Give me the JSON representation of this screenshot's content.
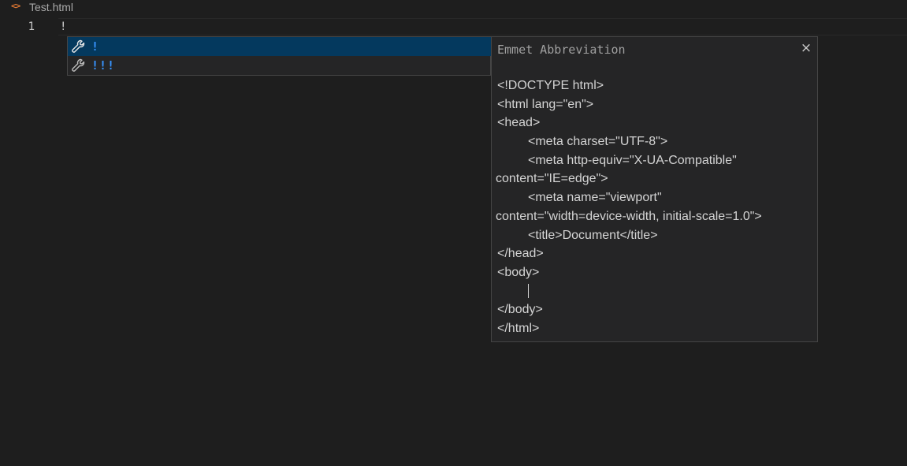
{
  "tab": {
    "icon": "html-file-icon",
    "file_icon_glyph": "<>",
    "file_name": "Test.html"
  },
  "editor": {
    "line_number": "1",
    "line_text": "!"
  },
  "suggest": {
    "items": [
      {
        "icon": "wrench-icon",
        "label": "!",
        "selected": true
      },
      {
        "icon": "wrench-icon",
        "label": "!!!",
        "selected": false
      }
    ],
    "label_color": "#3794ff"
  },
  "details": {
    "title": "Emmet Abbreviation",
    "close_glyph": "×",
    "lines": [
      "<!DOCTYPE html>",
      "<html lang=\"en\">",
      "<head>",
      "<meta charset=\"UTF-8\">",
      "<meta http-equiv=\"X-UA-Compatible\"",
      "content=\"IE=edge\">",
      "<meta name=\"viewport\"",
      "content=\"width=device-width, initial-scale=1.0\">",
      "<title>Document</title>",
      "</head>",
      "<body>",
      "",
      "</body>",
      "</html>"
    ]
  },
  "colors": {
    "background": "#1e1e1e",
    "widget_background": "#252526",
    "selection": "#04395e",
    "accent": "#3794ff",
    "html_icon": "#e37933"
  }
}
